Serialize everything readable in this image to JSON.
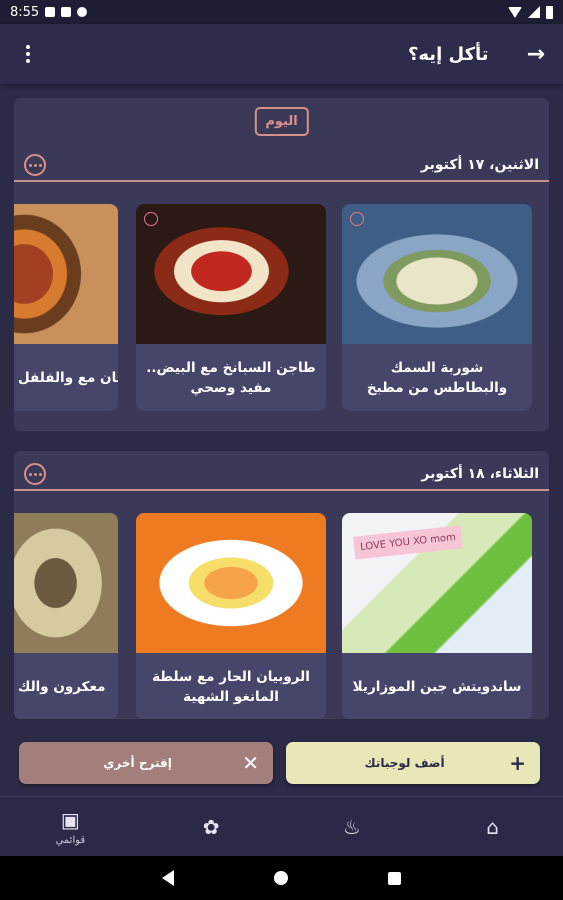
{
  "status_bar": {
    "time": "8:55"
  },
  "app_bar": {
    "title": "تأكل إيه؟"
  },
  "days": [
    {
      "today_label": "اليوم",
      "title": "الاثنين، ١٧ أكتوبر",
      "meals": [
        {
          "name": "شوربة السمك والبطاطس من مطبخ"
        },
        {
          "name": "طاجن السبانخ مع البيض.. مفيد وصحي"
        },
        {
          "name": "الباذنجان مع والفلفل"
        }
      ]
    },
    {
      "title": "الثلاثاء، ١٨ أكتوبر",
      "meals": [
        {
          "name": "ساندويتش جبن الموزاريلا",
          "note": "LOVE YOU XO mom"
        },
        {
          "name": "الروبيان الحار مع سلطة المانغو الشهية"
        },
        {
          "name": "معكرون والك"
        }
      ]
    }
  ],
  "actions": {
    "suggest_label": "إقترح أخري",
    "add_label": "أضف لوجباتك"
  },
  "bottom_nav": {
    "my_lists_label": "قوائمي"
  },
  "icons": {
    "suggest": "fork-knife-icon",
    "add": "plus-icon",
    "home": "home-icon",
    "chef": "chef-icon",
    "ingredients": "basket-icon",
    "lists": "recipe-book-icon"
  }
}
